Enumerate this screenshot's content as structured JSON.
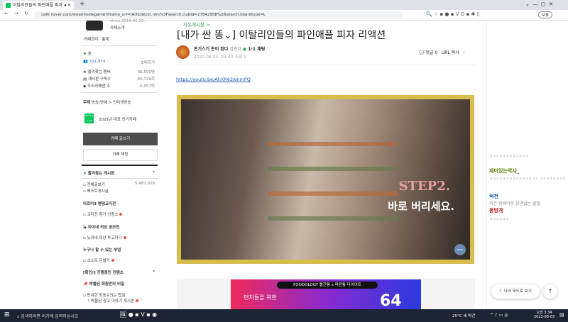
{
  "browser": {
    "tab_title": "이탈리안들의 파인애플 피자",
    "url": "cafe.naver.com/steamindiegame?iframe_url=/ArticleList.nhn%3Fsearch.clubid=27842958%26search.boardtype=L",
    "profile_label": "오류"
  },
  "sidebar": {
    "since": "since 2019.02.20.",
    "intro": "카페소개",
    "manage": "카페관리",
    "stats": "통계",
    "level": "숲",
    "members": "391,974",
    "invite": "초대하기",
    "stats_rows": [
      {
        "label": "즐겨찾는 멤버",
        "value": "40,550명"
      },
      {
        "label": "게시판 구독수",
        "value": "60,729회"
      },
      {
        "label": "우리카페앱 수",
        "value": "6,057회"
      }
    ],
    "topic_label": "주제",
    "topic": "방송/연예 > 인터넷방송",
    "naver_badge": "NAVER 대표카페",
    "award": "2021년 대표 인기카페",
    "write": "카페 글쓰기",
    "chat": "카페 채팅",
    "fav_boards": "즐겨찾는 게시판",
    "all_posts": "전체글보기",
    "all_count": "5,487,029",
    "best": "베스트게시글",
    "sec1": "아르미3 팬덤교지전",
    "sec1_item": "교지전 참가 신청소",
    "sec2": "뉴 아이네 의상 공모전",
    "sec2_item": "뉴이네 의상 투고하기",
    "sec3": "누구나 할 수 있는 부업",
    "sec3_item": "소소로 돈벌기",
    "sec4": "[확인!] 진행중인 컨텐츠",
    "sec5": "박물된 회원만의 비밀",
    "sec5_item1": "펀치한 방송수의는 합김",
    "sec5_item2": "박물된 광고 이야기 게시판"
  },
  "article": {
    "board": "자유게시판 >",
    "title": "[내가 싼 똥⌄] 이탈리인들의 파인애플 피자 리액션",
    "author": "돈기스기 돈이 된다",
    "grade": "김펀치",
    "chat_label": "1:1 채팅",
    "date": "2022.08.03. 03:33",
    "views": "조회 0",
    "comments": "댓글 0",
    "url_copy": "URL 복사",
    "link": "https://youtu.be/AhXR62wnmPQ",
    "video_caption1": "STEP2.",
    "video_caption2": "바로 버리세요.",
    "video_logo": "BODA",
    "ad_top": "FOODOLOGY 빨간통 x 파란통 다이어트",
    "ad_line": "펀치들을 위한",
    "ad_num": "64"
  },
  "chat": {
    "messages": [
      {
        "name": "",
        "text": "ㅋㅋㅋㅋㅋㅋㅋㅋㅋㅋㅋㅋ",
        "color": "#999"
      },
      {
        "name": "재미있는역사_",
        "text": "ㅋㅋㅋㅋㅋㅋㅋㅋㅋㅋㅋㅋㅋㅋㅋ ㅋㅋㅋㅋㅋㅋㅋㅋ",
        "color": "#5a7a00"
      },
      {
        "name": "럭천",
        "text": "저건 원웨이랑 상관없는 클립",
        "color": "#1a5fa8"
      },
      {
        "name": "몽방개",
        "text": "ㅋㅋㅋㅋㅋㅋ",
        "color": "#b01010"
      }
    ],
    "dark_mode": "다크 모드로 보기",
    "top": "↑"
  },
  "taskbar": {
    "search": "검색하려면 여기에 입력하십시오",
    "weather": "25°C 세 막간",
    "time": "오전 3:34",
    "date": "2022-08-03"
  }
}
